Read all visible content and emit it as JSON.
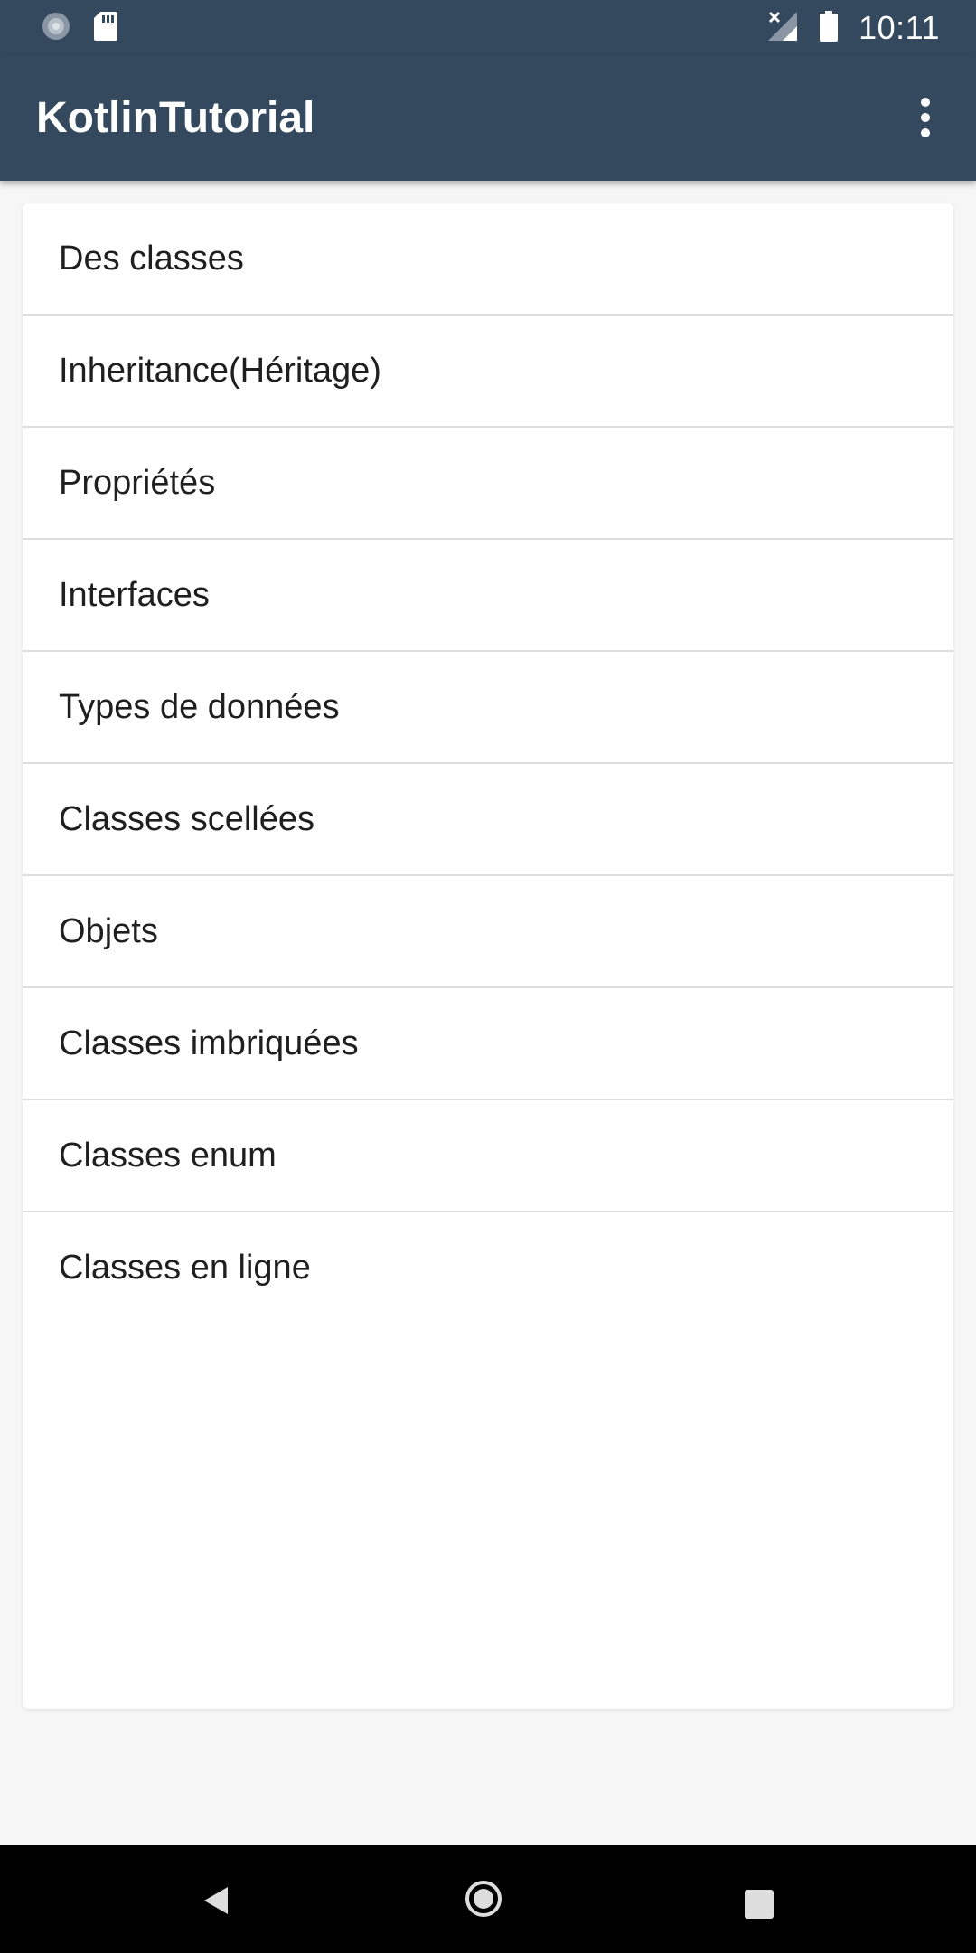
{
  "status_bar": {
    "time": "10:11",
    "icons": [
      "sync-icon",
      "sd-card-icon",
      "signal-off-icon",
      "battery-icon"
    ]
  },
  "app_bar": {
    "title": "KotlinTutorial",
    "overflow_icon": "more-vert-icon"
  },
  "list": {
    "items": [
      {
        "label": "Des classes"
      },
      {
        "label": "Inheritance(Héritage)"
      },
      {
        "label": "Propriétés"
      },
      {
        "label": "Interfaces"
      },
      {
        "label": "Types de données"
      },
      {
        "label": "Classes scellées"
      },
      {
        "label": "Objets"
      },
      {
        "label": "Classes imbriquées"
      },
      {
        "label": "Classes enum"
      },
      {
        "label": "Classes en ligne"
      }
    ]
  },
  "nav_bar": {
    "icons": [
      "back-icon",
      "home-icon",
      "recents-icon"
    ]
  },
  "colors": {
    "primary": "#34495e",
    "background": "#f6f6f6",
    "card": "#ffffff",
    "divider": "#dedede"
  }
}
